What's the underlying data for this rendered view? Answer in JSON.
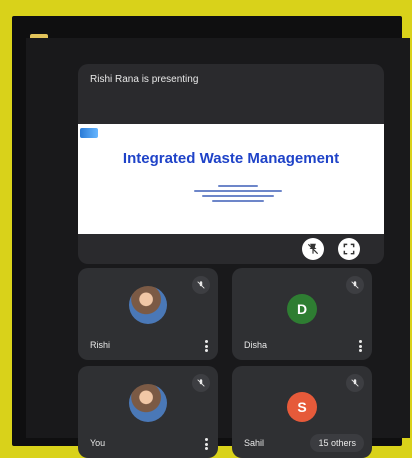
{
  "presenter_banner": "Rishi Rana is presenting",
  "slide": {
    "title": "Integrated Waste Management"
  },
  "controls": {
    "pin_icon": "pin-icon",
    "fullscreen_icon": "fullscreen-icon"
  },
  "participants": [
    {
      "name": "Rishi",
      "type": "photo"
    },
    {
      "name": "Disha",
      "type": "letter",
      "initial": "D",
      "color": "#2e7d32"
    },
    {
      "name": "You",
      "type": "photo"
    },
    {
      "name": "Sahil",
      "type": "letter",
      "initial": "S",
      "color": "#e65a3a",
      "others_label": "15 others"
    }
  ]
}
